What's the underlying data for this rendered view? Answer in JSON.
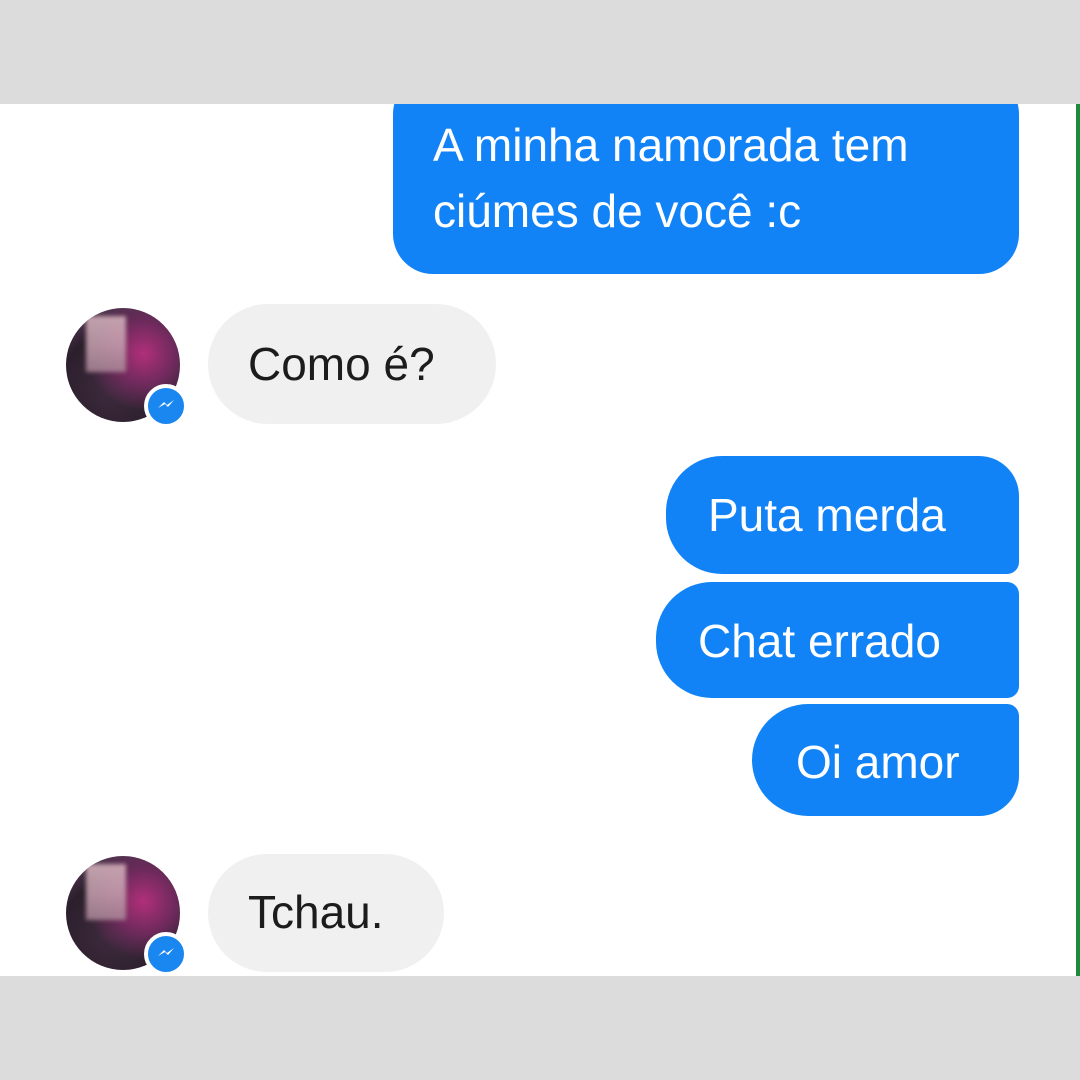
{
  "messages": [
    {
      "side": "out",
      "text": "A minha namorada tem ciúmes de você :c"
    },
    {
      "side": "in",
      "text": "Como é?"
    },
    {
      "side": "out",
      "text": "Puta merda"
    },
    {
      "side": "out",
      "text": "Chat errado"
    },
    {
      "side": "out",
      "text": "Oi amor"
    },
    {
      "side": "in",
      "text": "Tchau."
    }
  ],
  "contact": {
    "avatar_icon": "profile-photo",
    "badge_icon": "messenger-icon"
  },
  "colors": {
    "outgoing_bubble": "#1283f7",
    "incoming_bubble": "#f1f0f0",
    "badge": "#1a86f0"
  }
}
